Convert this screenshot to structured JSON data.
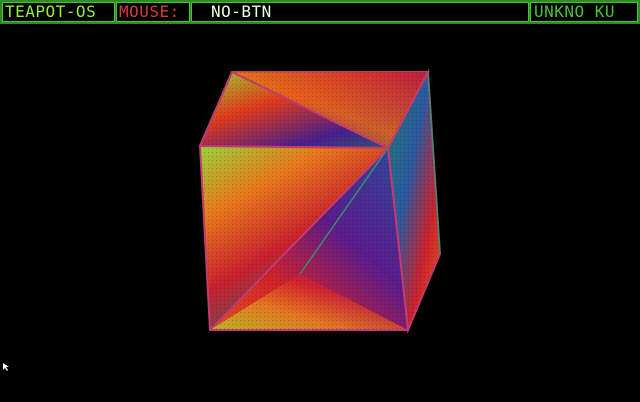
{
  "status_bar": {
    "os_label": "TEAPOT-OS",
    "mouse_label": "MOUSE:",
    "mouse_value": "NO-BTN",
    "status_text": "UNKNO KU"
  },
  "colors": {
    "bar_green": "#2e8b22",
    "border_green": "#49c23a",
    "os_text": "#8fef3c",
    "mouse_label_text": "#d63a3a",
    "value_text": "#e9ffe0",
    "cube_edge": "#c23a6e"
  },
  "viewport": {
    "object": "shaded-wireframe-cube-icon"
  },
  "pointer": {
    "icon": "mouse-pointer-icon"
  }
}
